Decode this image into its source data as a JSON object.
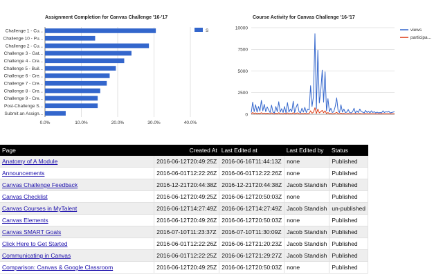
{
  "chart_data": [
    {
      "type": "bar",
      "orientation": "horizontal",
      "title": "Assignment Completion for Canvas Challenge '16-'17",
      "categories": [
        "Challenge 1 - Cu...",
        "Challenge 10 - Pu...",
        "Challenge 2 - Cu...",
        "Challenge 3 - Gat...",
        "Challenge 4 - Cre...",
        "Challenge 5 - Buil...",
        "Challenge 6 - Cre...",
        "Challenge 7 - Cre...",
        "Challenge 8 - Cre...",
        "Challenge 9 - Cre...",
        "Post-Challenge S...",
        "Submit an Assign..."
      ],
      "series": [
        {
          "name": "S",
          "values": [
            30.5,
            13.8,
            28.6,
            23.8,
            21.8,
            19.5,
            17.8,
            17.0,
            15.2,
            14.5,
            14.5,
            5.7
          ]
        }
      ],
      "x_ticks": [
        "0.0%",
        "10.0%",
        "20.0%",
        "30.0%",
        "40.0%"
      ],
      "xlim": [
        0,
        40
      ],
      "color": "#3366cc",
      "legend": "right",
      "grid": true
    },
    {
      "type": "line",
      "title": "Course Activity for Canvas Challenge '16-'17",
      "y_ticks": [
        "0",
        "2500",
        "5000",
        "7500",
        "10000"
      ],
      "ylim": [
        0,
        10000
      ],
      "legend": "right",
      "grid": true,
      "series": [
        {
          "name": "views",
          "color": "#3366cc",
          "values": [
            200,
            1400,
            300,
            1100,
            250,
            900,
            350,
            1600,
            400,
            1150,
            300,
            850,
            500,
            200,
            1050,
            250,
            150,
            900,
            300,
            1450,
            250,
            650,
            200,
            900,
            150,
            1350,
            250,
            600,
            300,
            1500,
            200,
            800,
            1200,
            300,
            150,
            700,
            250,
            800,
            200,
            600,
            500,
            3300,
            900,
            2100,
            9300,
            600,
            7400,
            1300,
            2700,
            5100,
            1400,
            4900,
            400,
            1800,
            300,
            700,
            200,
            300,
            900,
            1900,
            400,
            200,
            1100,
            250,
            600,
            200,
            250,
            550,
            200,
            150,
            300,
            700,
            150,
            400,
            200,
            600,
            300,
            250,
            150,
            450,
            200,
            350,
            150,
            400,
            200,
            300,
            150,
            250,
            150,
            200,
            150,
            400,
            200,
            300,
            250,
            350,
            150,
            200,
            250,
            300
          ]
        },
        {
          "name": "participa...",
          "color": "#dc3912",
          "values": [
            50,
            200,
            80,
            150,
            60,
            120,
            70,
            180,
            90,
            140,
            70,
            120,
            100,
            60,
            150,
            70,
            50,
            120,
            60,
            180,
            60,
            100,
            50,
            130,
            40,
            160,
            50,
            90,
            60,
            180,
            50,
            110,
            160,
            60,
            40,
            90,
            60,
            110,
            50,
            80,
            90,
            400,
            120,
            250,
            750,
            90,
            600,
            160,
            300,
            450,
            180,
            400,
            80,
            200,
            60,
            100,
            50,
            60,
            130,
            220,
            70,
            50,
            140,
            60,
            90,
            50,
            60,
            80,
            50,
            40,
            60,
            100,
            40,
            70,
            50,
            80,
            60,
            50,
            40,
            70,
            50,
            60,
            40,
            60,
            50,
            60,
            40,
            50,
            40,
            50,
            40,
            70,
            50,
            60,
            50,
            60,
            40,
            50,
            50,
            60
          ]
        }
      ]
    }
  ],
  "table": {
    "headers": [
      "Page",
      "Created At",
      "Last Edited at",
      "Last Edited by",
      "Status"
    ],
    "rows": [
      [
        "Anatomy of A Module",
        "2016-06-12T20:49:25Z",
        "2016-06-16T11:44:13Z",
        "none",
        "Published"
      ],
      [
        "Announcements",
        "2016-06-01T12:22:26Z",
        "2016-06-01T12:22:26Z",
        "none",
        "Published"
      ],
      [
        "Canvas Challenge Feedback",
        "2016-12-21T20:44:38Z",
        "2016-12-21T20:44:38Z",
        "Jacob Standish",
        "Published"
      ],
      [
        "Canvas Checklist",
        "2016-06-12T20:49:25Z",
        "2016-06-12T20:50:03Z",
        "none",
        "Published"
      ],
      [
        "Canvas Courses in MyTalent",
        "2016-06-12T14:27:49Z",
        "2016-06-12T14:27:49Z",
        "Jacob Standish",
        "un-published"
      ],
      [
        "Canvas Elements",
        "2016-06-12T20:49:26Z",
        "2016-06-12T20:50:03Z",
        "none",
        "Published"
      ],
      [
        "Canvas SMART Goals",
        "2016-07-10T11:23:37Z",
        "2016-07-10T11:30:09Z",
        "Jacob Standish",
        "Published"
      ],
      [
        "Click Here to Get Started",
        "2016-06-01T12:22:26Z",
        "2016-06-12T21:20:23Z",
        "Jacob Standish",
        "Published"
      ],
      [
        "Communicating in Canvas",
        "2016-06-01T12:22:25Z",
        "2016-06-12T21:29:27Z",
        "Jacob Standish",
        "Published"
      ],
      [
        "Comparison: Canvas & Google Classroom",
        "2016-06-12T20:49:25Z",
        "2016-06-12T20:50:03Z",
        "none",
        "Published"
      ]
    ]
  }
}
